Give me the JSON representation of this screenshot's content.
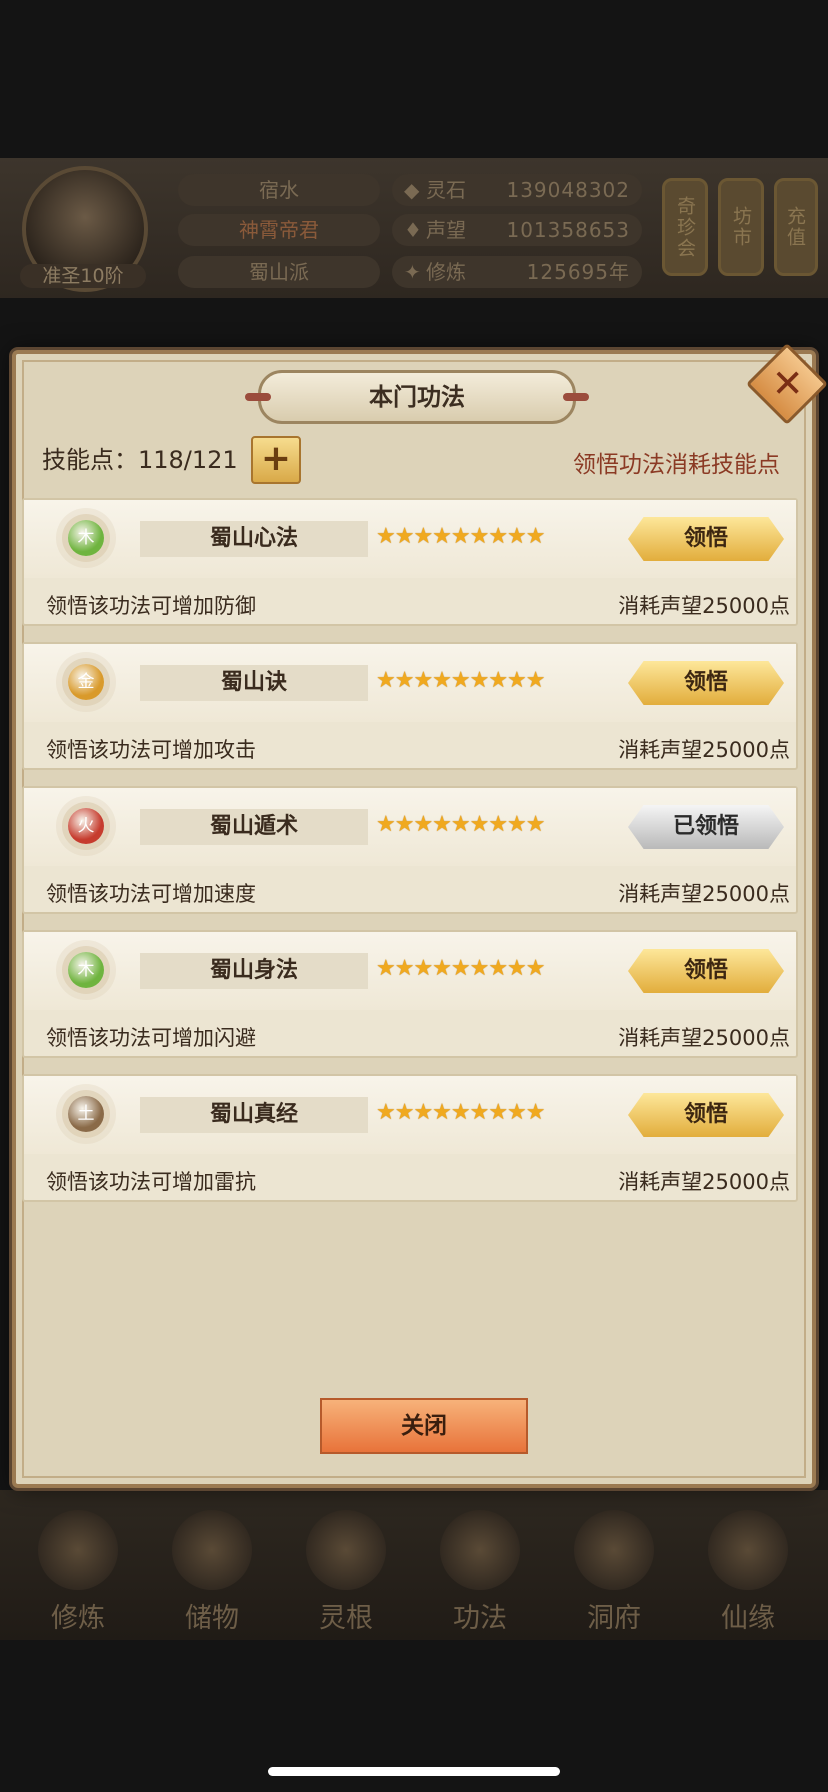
{
  "background": {
    "player": {
      "rank": "准圣10阶",
      "name": "宿水",
      "title": "神霄帝君",
      "sect": "蜀山派"
    },
    "stats": [
      {
        "label": "灵石",
        "value": "139048302"
      },
      {
        "label": "声望",
        "value": "101358653"
      },
      {
        "label": "修炼",
        "value": "125695年"
      }
    ],
    "side_buttons": [
      "奇珍会",
      "坊市",
      "充值"
    ],
    "bottom_nav": [
      "修炼",
      "储物",
      "灵根",
      "功法",
      "洞府",
      "仙缘"
    ]
  },
  "modal": {
    "title": "本门功法",
    "skill_points_label": "技能点：118/121",
    "plus_label": "+",
    "hint": "领悟功法消耗技能点",
    "close_label": "关闭",
    "skills": [
      {
        "element": "木",
        "element_color": "#6fb43f",
        "name": "蜀山心法",
        "stars": "★★★★★★★★★",
        "button": "领悟",
        "done": false,
        "desc": "领悟该功法可增加防御",
        "cost": "消耗声望25000点"
      },
      {
        "element": "金",
        "element_color": "#d99a2b",
        "name": "蜀山诀",
        "stars": "★★★★★★★★★",
        "button": "领悟",
        "done": false,
        "desc": "领悟该功法可增加攻击",
        "cost": "消耗声望25000点"
      },
      {
        "element": "火",
        "element_color": "#c63c2e",
        "name": "蜀山遁术",
        "stars": "★★★★★★★★★",
        "button": "已领悟",
        "done": true,
        "desc": "领悟该功法可增加速度",
        "cost": "消耗声望25000点"
      },
      {
        "element": "木",
        "element_color": "#6fb43f",
        "name": "蜀山身法",
        "stars": "★★★★★★★★★",
        "button": "领悟",
        "done": false,
        "desc": "领悟该功法可增加闪避",
        "cost": "消耗声望25000点"
      },
      {
        "element": "土",
        "element_color": "#8a6a48",
        "name": "蜀山真经",
        "stars": "★★★★★★★★★",
        "button": "领悟",
        "done": false,
        "desc": "领悟该功法可增加雷抗",
        "cost": "消耗声望25000点"
      }
    ]
  }
}
